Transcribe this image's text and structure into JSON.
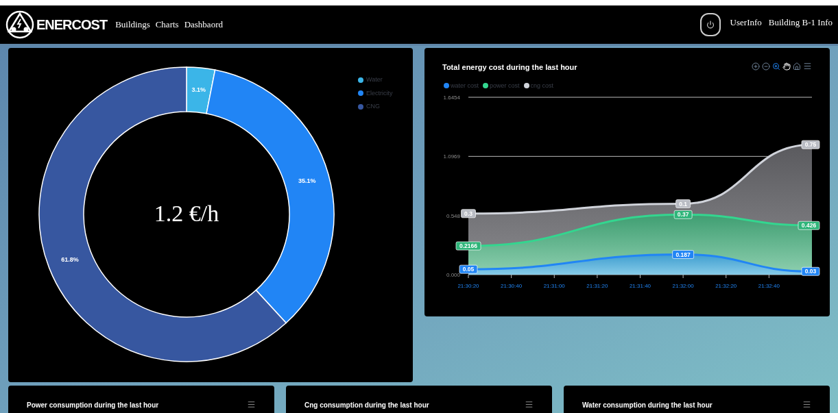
{
  "header": {
    "brand": "ENERCOST",
    "nav": [
      {
        "label": "Buildings"
      },
      {
        "label": "Charts"
      },
      {
        "label": "Dashbaord"
      }
    ],
    "right_links": [
      {
        "label": "UserInfo"
      },
      {
        "label": "Building B-1 Info"
      }
    ]
  },
  "donut_panel": {
    "center_text": "1.2 €/h",
    "chart_data": {
      "type": "donut",
      "categories": [
        "Water",
        "Electricity",
        "CNG"
      ],
      "values": [
        3.1,
        35.1,
        61.8
      ],
      "colors": [
        "#3bb5e8",
        "#2185f5",
        "#3757a0"
      ],
      "value_labels": [
        "3.1%",
        "35.1%",
        "61.8%"
      ]
    }
  },
  "cost_panel": {
    "title": "Total energy cost during the last hour",
    "chart_data": {
      "type": "area",
      "stacked": true,
      "categories": [
        "21:30:20",
        "21:30:40",
        "21:31:00",
        "21:31:20",
        "21:31:40",
        "21:32:00",
        "21:32:20",
        "21:32:40",
        null
      ],
      "ylim": [
        0,
        1.6454
      ],
      "yticks": [
        {
          "value": 0,
          "label": "0.000"
        },
        {
          "value": 0.548,
          "label": "0.548"
        },
        {
          "value": 1.0969,
          "label": "1.0969"
        },
        {
          "value": 1.6454,
          "label": "1.6454"
        }
      ],
      "data_labels": true,
      "series": [
        {
          "name": "water cost",
          "color": "#2185f5",
          "values": [
            0.05,
            null,
            null,
            null,
            null,
            0.187,
            null,
            null,
            0.03
          ]
        },
        {
          "name": "power cost",
          "color": "#33d68f",
          "values": [
            0.2166,
            null,
            null,
            null,
            null,
            0.37,
            null,
            null,
            0.426
          ]
        },
        {
          "name": "cng cost",
          "color": "#d0d3da",
          "values": [
            0.3,
            null,
            null,
            null,
            null,
            0.1,
            null,
            null,
            0.75
          ]
        }
      ]
    }
  },
  "cards": [
    {
      "title": "Power consumption during the last hour"
    },
    {
      "title": "Cng consumption during the last hour"
    },
    {
      "title": "Water consumption during the last hour"
    }
  ]
}
